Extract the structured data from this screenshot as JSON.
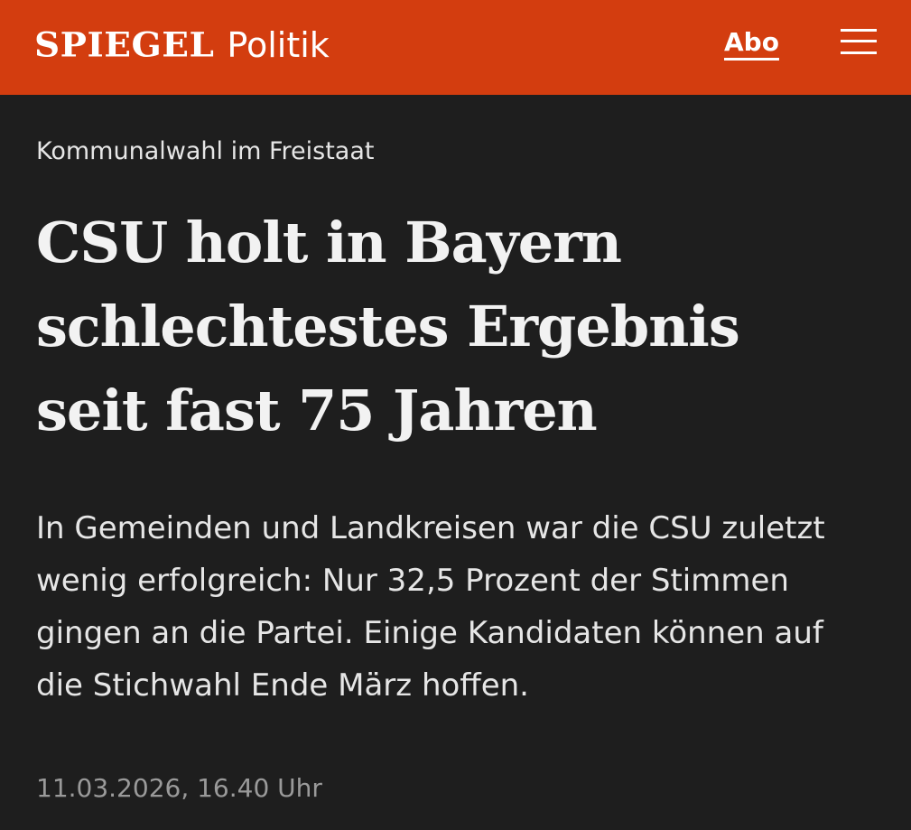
{
  "header": {
    "logo_text": "SPIEGEL",
    "section": "Politik",
    "abo_label": "Abo",
    "menu_icon": "hamburger-menu-icon",
    "background_color": "#d33d0f"
  },
  "article": {
    "kicker": "Kommunalwahl im Freistaat",
    "headline": "CSU holt in Bayern schlechtestes Ergebnis seit fast 75 Jahren",
    "teaser": "In Gemeinden und Landkreisen war die CSU zuletzt wenig erfolgreich: Nur 32,5 Prozent der Stimmen gingen an die Partei. Einige Kandidaten können auf die Stichwahl Ende März hoffen.",
    "date": "11.03.2026, 16.40 Uhr",
    "background_color": "#1e1e1e"
  }
}
